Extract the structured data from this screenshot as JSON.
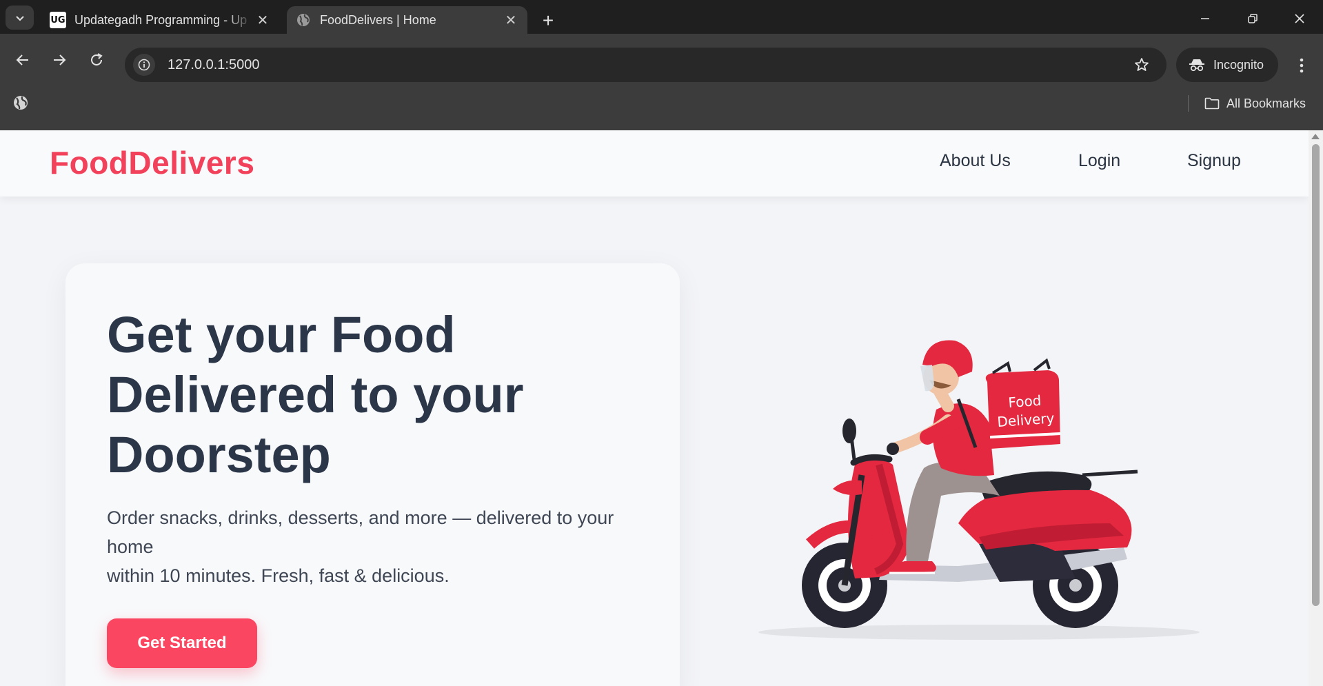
{
  "browser": {
    "tabs": [
      {
        "title": "Updategadh Programming - Up",
        "favicon": "ug-logo-icon",
        "active": false
      },
      {
        "title": "FoodDelivers | Home",
        "favicon": "globe-icon",
        "active": true
      }
    ],
    "address": "127.0.0.1:5000",
    "incognito_label": "Incognito",
    "bookmarks_label": "All Bookmarks"
  },
  "site": {
    "brand": "FoodDelivers",
    "nav": {
      "about": "About Us",
      "login": "Login",
      "signup": "Signup"
    },
    "hero": {
      "title": "Get your Food Delivered to your Doorstep",
      "text_line1": "Order snacks, drinks, desserts, and more — delivered to your home",
      "text_line2": "within 10 minutes. Fresh, fast & delicious.",
      "cta": "Get Started"
    },
    "illustration": {
      "box_line1": "Food",
      "box_line2": "Delivery"
    }
  },
  "colors": {
    "brand": "#f2415a",
    "cta": "#fa4661",
    "heading": "#2b3648",
    "scooter_red": "#e3283f"
  }
}
